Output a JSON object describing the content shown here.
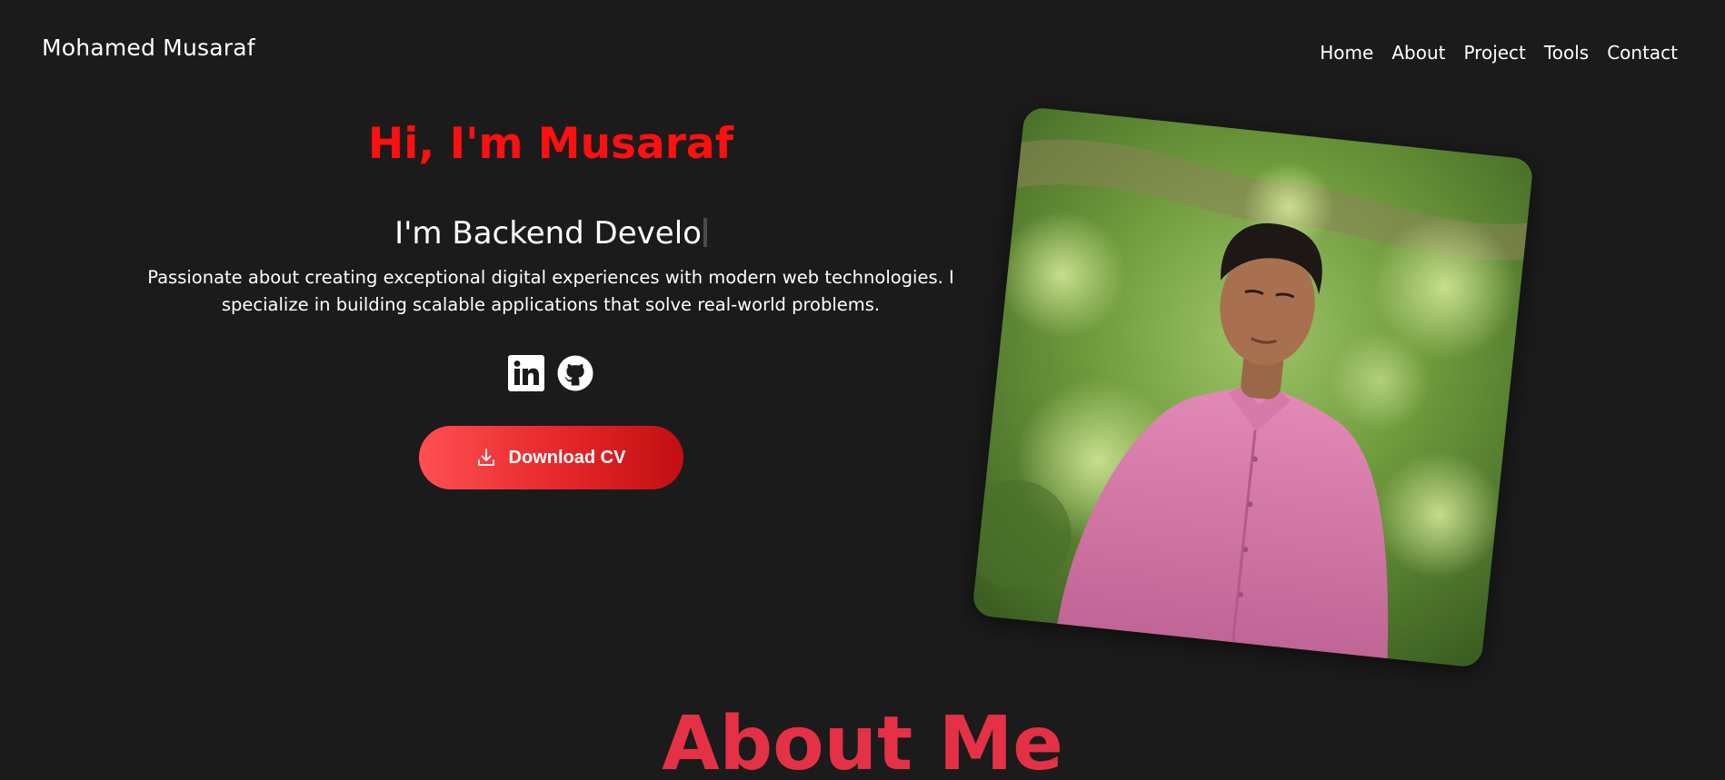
{
  "header": {
    "brand": "Mohamed Musaraf",
    "nav": [
      "Home",
      "About",
      "Project",
      "Tools",
      "Contact"
    ]
  },
  "hero": {
    "greeting": "Hi, I'm Musaraf",
    "role_typed": "I'm Backend Develo",
    "bio": "Passionate about creating exceptional digital experiences with modern web technologies. I specialize in building scalable applications that solve real-world problems.",
    "socials": [
      "linkedin-icon",
      "github-icon"
    ],
    "cv_button": "Download CV",
    "cv_icon": "download-icon"
  },
  "about": {
    "heading": "About Me"
  },
  "colors": {
    "background": "#1b1b1b",
    "greeting": "#ff0f0f",
    "about_heading": "#e43146",
    "button_start": "#ff5052",
    "button_end": "#c20f12"
  }
}
